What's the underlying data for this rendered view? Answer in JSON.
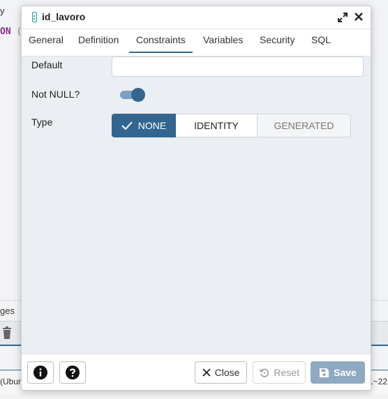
{
  "background": {
    "left_top_text": "y",
    "sql_keyword": "ON",
    "sql_paren": "(",
    "panel_label": "ges",
    "status_left": "(Ubur",
    "status_right": "1~22"
  },
  "dialog": {
    "title": "id_lavoro",
    "tabs": [
      {
        "label": "General"
      },
      {
        "label": "Definition"
      },
      {
        "label": "Constraints"
      },
      {
        "label": "Variables"
      },
      {
        "label": "Security"
      },
      {
        "label": "SQL"
      }
    ],
    "active_tab": "Constraints",
    "form": {
      "default_label": "Default",
      "default_value": "",
      "not_null_label": "Not NULL?",
      "not_null_on": true,
      "type_label": "Type",
      "type_options": [
        "NONE",
        "IDENTITY",
        "GENERATED"
      ],
      "type_selected": "NONE"
    },
    "footer": {
      "close_label": "Close",
      "reset_label": "Reset",
      "save_label": "Save"
    }
  },
  "colors": {
    "accent": "#326690",
    "teal_icon": "#1aa196",
    "save_disabled": "#8fa9c2"
  }
}
